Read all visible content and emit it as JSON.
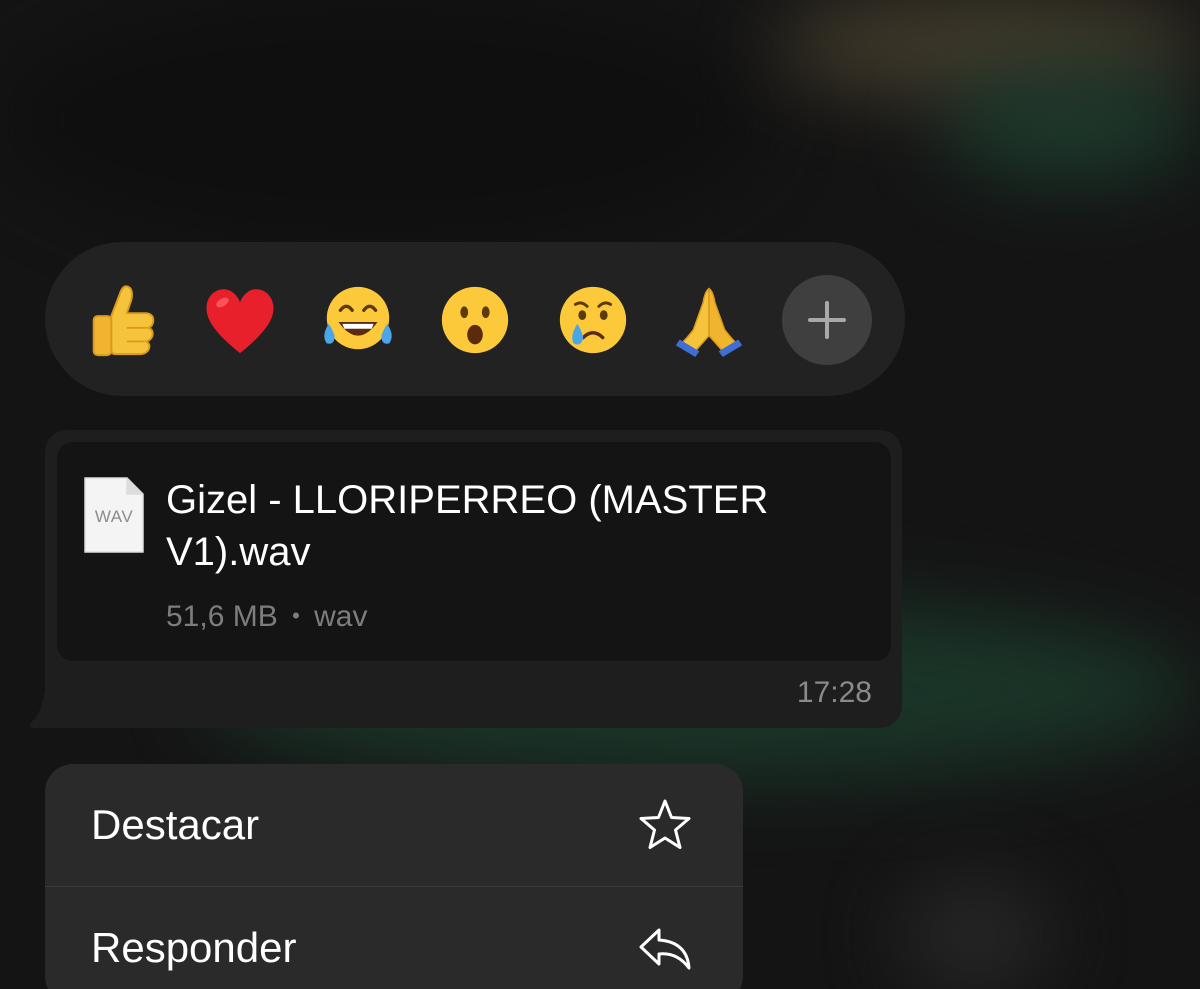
{
  "reactions": {
    "emojis": [
      {
        "name": "thumbs-up",
        "char": "👍"
      },
      {
        "name": "red-heart",
        "char": "❤️"
      },
      {
        "name": "tears-of-joy",
        "char": "😂"
      },
      {
        "name": "open-mouth",
        "char": "😮"
      },
      {
        "name": "crying-face",
        "char": "😢"
      },
      {
        "name": "folded-hands",
        "char": "🙏"
      }
    ],
    "more_icon": "plus-icon"
  },
  "message": {
    "file": {
      "type_badge": "WAV",
      "name_line1": "Gizel - LLORIPERREO (MASTER",
      "name_line2": "V1).wav",
      "size": "51,6 MB",
      "separator": "•",
      "extension": "wav"
    },
    "time": "17:28"
  },
  "menu": {
    "items": [
      {
        "label": "Destacar",
        "icon": "star-icon"
      },
      {
        "label": "Responder",
        "icon": "reply-icon"
      }
    ]
  },
  "colors": {
    "background": "#141414",
    "bubble": "#1e1e1f",
    "menu": "#2a2a2b",
    "accent_text": "#ffffff",
    "muted_text": "#7d7d7f"
  }
}
